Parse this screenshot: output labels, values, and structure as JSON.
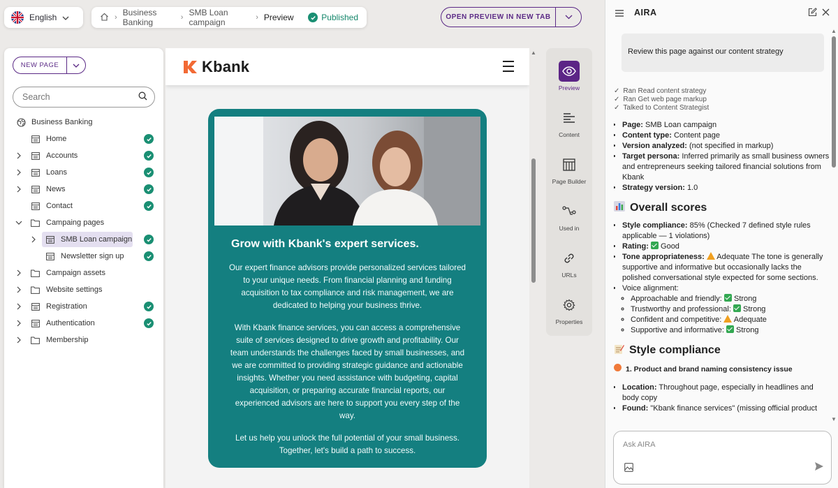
{
  "topbar": {
    "language": "English",
    "breadcrumb": [
      "Business Banking",
      "SMB Loan campaign",
      "Preview"
    ],
    "status": "Published",
    "open_preview_label": "OPEN PREVIEW IN NEW TAB"
  },
  "sidebar": {
    "new_page_label": "NEW PAGE",
    "search_placeholder": "Search",
    "root_label": "Business Banking",
    "items": [
      {
        "label": "Home",
        "published": true
      },
      {
        "label": "Accounts",
        "published": true
      },
      {
        "label": "Loans",
        "published": true
      },
      {
        "label": "News",
        "published": true
      },
      {
        "label": "Contact",
        "published": true
      },
      {
        "label": "Campaing pages"
      },
      {
        "label": "SMB Loan campaign",
        "published": true
      },
      {
        "label": "Newsletter sign up",
        "published": true
      },
      {
        "label": "Campaign assets"
      },
      {
        "label": "Website settings"
      },
      {
        "label": "Registration",
        "published": true
      },
      {
        "label": "Authentication",
        "published": true
      },
      {
        "label": "Membership"
      }
    ]
  },
  "preview": {
    "brand": "Kbank",
    "brand_color": "#f26a35",
    "card_color": "#147f80",
    "heading": "Grow with Kbank's expert services.",
    "paragraph1": "Our expert finance advisors provide personalized services tailored to your unique needs. From financial planning and funding acquisition to tax compliance and risk management, we are dedicated to helping your business thrive.",
    "paragraph2": "With Kbank finance services, you can access a comprehensive suite of services designed to drive growth and profitability. Our team understands the challenges faced by small businesses, and we are committed to providing strategic guidance and actionable insights. Whether you need assistance with budgeting, capital acquisition, or preparing accurate financial reports, our experienced advisors are here to support you every step of the way.",
    "paragraph3": "Let us help you unlock the full potential of your small business. Together, let's build a path to success."
  },
  "tools": {
    "preview": "Preview",
    "content": "Content",
    "page_builder": "Page Builder",
    "used_in": "Used in",
    "urls": "URLs",
    "properties": "Properties"
  },
  "aira": {
    "title": "AIRA",
    "user_prompt": "Review this page against our content strategy",
    "ran": [
      "Ran Read content strategy",
      "Ran Get web page markup",
      "Talked to Content Strategist"
    ],
    "summary": {
      "page_label": "Page:",
      "page": "SMB Loan campaign",
      "type_label": "Content type:",
      "type": "Content page",
      "version_label": "Version analyzed:",
      "version": "(not specified in markup)",
      "persona_label": "Target persona:",
      "persona": "Inferred primarily as small business owners and entrepreneurs seeking tailored financial solutions from Kbank",
      "strategy_label": "Strategy version:",
      "strategy": "1.0"
    },
    "scores_heading": "Overall scores",
    "scores": {
      "style_label": "Style compliance:",
      "style": "85% (Checked 7 defined style rules applicable — 1 violations)",
      "rating_label": "Rating:",
      "rating": "Good",
      "tone_label": "Tone appropriateness:",
      "tone": "Adequate The tone is generally supportive and informative but occasionally lacks the polished conversational style expected for some sections.",
      "voice_label": "Voice alignment:",
      "voice": [
        {
          "label": "Approachable and friendly:",
          "value": "Strong",
          "level": "good"
        },
        {
          "label": "Trustworthy and professional:",
          "value": "Strong",
          "level": "good"
        },
        {
          "label": "Confident and competitive:",
          "value": "Adequate",
          "level": "warn"
        },
        {
          "label": "Supportive and informative:",
          "value": "Strong",
          "level": "good"
        }
      ]
    },
    "style_heading": "Style compliance",
    "issue_title": "1. Product and brand naming consistency issue",
    "location_label": "Location:",
    "location": "Throughout page, especially in headlines and body copy",
    "found_label": "Found:",
    "found": "\"Kbank finance services\" (missing official product",
    "ask_placeholder": "Ask AIRA"
  }
}
